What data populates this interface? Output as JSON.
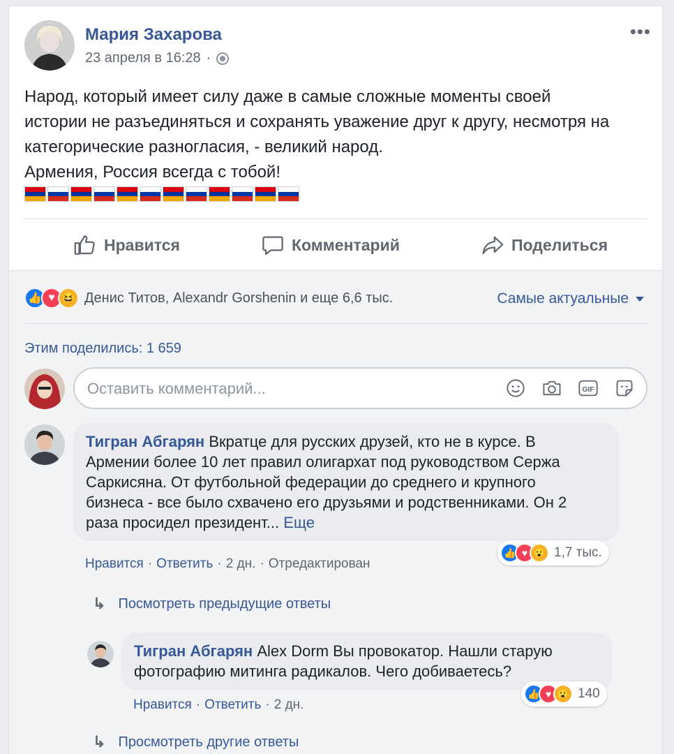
{
  "post": {
    "author": "Мария Захарова",
    "timestamp": "23 апреля в 16:28",
    "separator": "·",
    "privacy_icon": "globe-icon",
    "more_icon": "more-options-icon",
    "text_lines": [
      "Народ, который имеет силу даже в самые сложные моменты своей",
      "истории не разъединяться и сохранять уважение друг к другу, несмотря на",
      "категорические разногласия, - великий народ.",
      "Армения, Россия всегда с тобой!"
    ],
    "flags": [
      "armenia",
      "russia",
      "armenia",
      "russia",
      "armenia",
      "russia",
      "armenia",
      "russia",
      "armenia",
      "russia",
      "armenia",
      "russia"
    ],
    "flag_colors": {
      "armenia": [
        "#d90012",
        "#0033a0",
        "#f2a800"
      ],
      "russia": [
        "#ffffff",
        "#0039a6",
        "#d52b1e"
      ]
    }
  },
  "actions": {
    "like": "Нравится",
    "comment": "Комментарий",
    "share": "Поделиться"
  },
  "reactions": {
    "types": [
      "like",
      "love",
      "haha"
    ],
    "summary": "Денис Титов, Alexandr Gorshenin и еще 6,6 тыс.",
    "sort_label": "Самые актуальные"
  },
  "shares": {
    "label": "Этим поделились: 1 659"
  },
  "composer": {
    "placeholder": "Оставить комментарий...",
    "icons": [
      "emoji-icon",
      "camera-icon",
      "gif-icon",
      "sticker-icon"
    ]
  },
  "comments": [
    {
      "author": "Тигран Абгарян",
      "text_lines": [
        "Вкратце для русских друзей, кто не в курсе. В",
        "Армении более 10 лет правил олигархат под руководством Сержа",
        "Саркисяна. От футбольной федерации до среднего и крупного",
        "бизнеса - все было схвачено его друзьями и родственниками. Он 2",
        "раза просидел президент..."
      ],
      "see_more": "Еще",
      "like": "Нравится",
      "reply": "Ответить",
      "age": "2 дн.",
      "edited": "Отредактирован",
      "reaction_types": [
        "like",
        "love",
        "wow"
      ],
      "reaction_count": "1,7 тыс."
    },
    {
      "author": "Тигран Абгарян",
      "text_lines": [
        "Alex Dorm Вы провокатор. Нашли старую",
        "фотографию митинга радикалов. Чего добиваетесь?"
      ],
      "like": "Нравится",
      "reply": "Ответить",
      "age": "2 дн.",
      "reaction_types": [
        "like",
        "love",
        "wow"
      ],
      "reaction_count": "140"
    }
  ],
  "reply_links": {
    "previous": "Посмотреть предыдущие ответы",
    "other": "Просмотреть другие ответы"
  },
  "dot": "·",
  "colors": {
    "link": "#365899",
    "like_blue": "#1877f2",
    "love_red": "#f33e58",
    "haha_yellow": "#f7b125"
  }
}
